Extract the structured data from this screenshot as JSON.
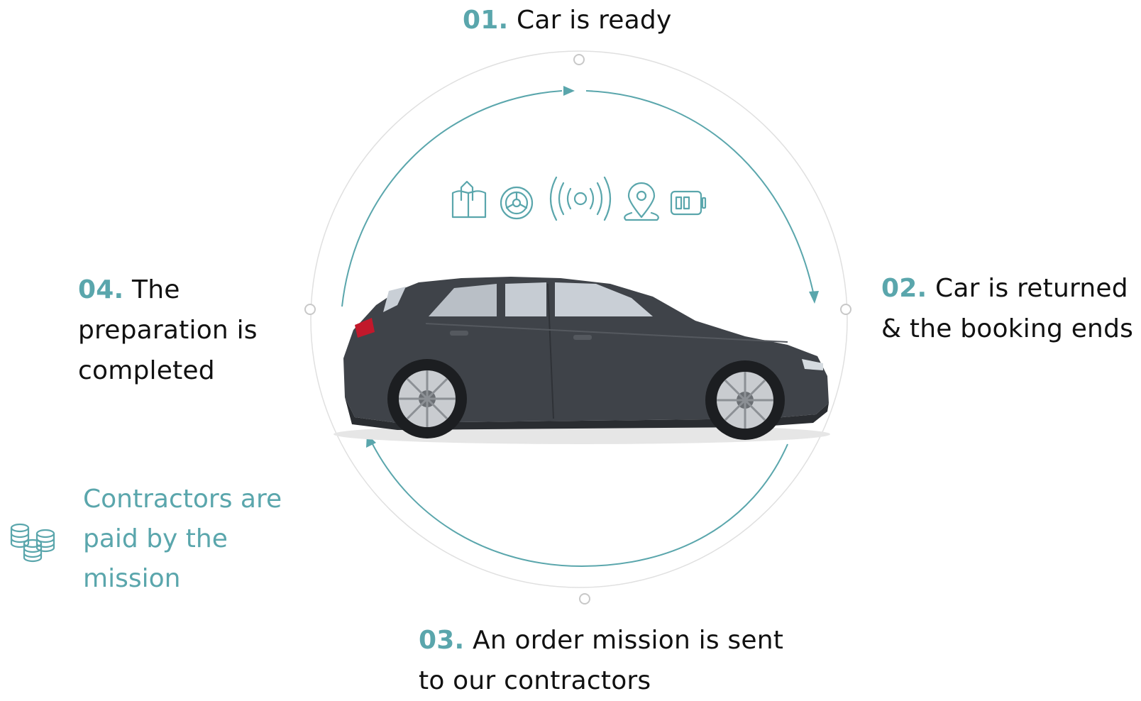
{
  "steps": [
    {
      "number": "01.",
      "text": "Car is ready"
    },
    {
      "number": "02.",
      "text": "Car is returned & the booking ends"
    },
    {
      "number": "03.",
      "text": "An order mission is sent to our contractors"
    },
    {
      "number": "04.",
      "text": "The preparation is completed"
    }
  ],
  "payment_note": "Contractors are paid by the mission",
  "icons": [
    "map-book-icon",
    "steering-wheel-icon",
    "connectivity-signal-icon",
    "location-pin-icon",
    "battery-icon",
    "coin-stacks-icon"
  ],
  "colors": {
    "accent": "#5aa6ac",
    "text": "#111111",
    "ring": "#e0e0e0",
    "car_body": "#3f4349"
  }
}
